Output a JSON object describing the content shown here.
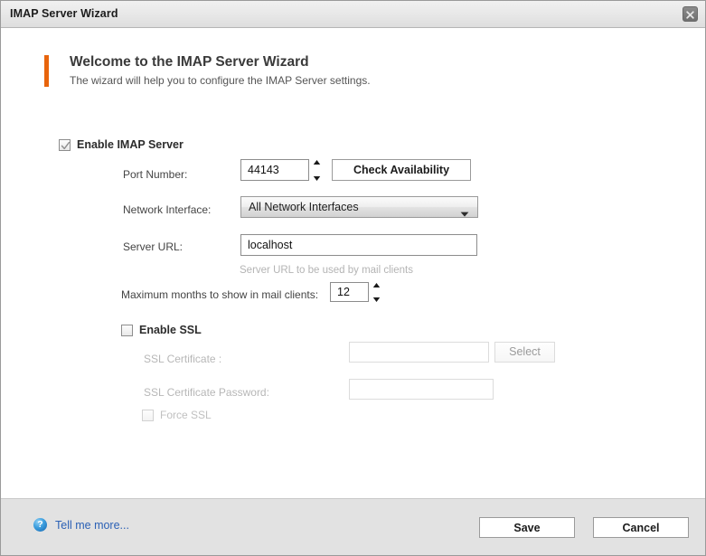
{
  "window": {
    "title": "IMAP Server Wizard",
    "close_icon": "close-icon"
  },
  "header": {
    "title": "Welcome to the IMAP Server Wizard",
    "subtitle": "The wizard will help you to configure the IMAP Server settings.",
    "accent_color": "#e8640c"
  },
  "form": {
    "enable_imap": {
      "label": "Enable IMAP Server",
      "checked": true
    },
    "port": {
      "label": "Port Number:",
      "value": "44143",
      "check_button": "Check Availability"
    },
    "network_interface": {
      "label": "Network Interface:",
      "selected": "All Network Interfaces",
      "options": [
        "All Network Interfaces"
      ]
    },
    "server_url": {
      "label": "Server URL:",
      "value": "localhost",
      "hint": "Server URL to be used by mail clients"
    },
    "max_months": {
      "label": "Maximum months to show in mail clients:",
      "value": "12"
    },
    "enable_ssl": {
      "label": "Enable SSL",
      "checked": false
    },
    "ssl_certificate": {
      "label": "SSL Certificate :",
      "value": "",
      "select_button": "Select"
    },
    "ssl_certificate_password": {
      "label": "SSL Certificate Password:",
      "value": ""
    },
    "force_ssl": {
      "label": "Force SSL",
      "checked": false
    }
  },
  "footer": {
    "help_icon": "help-question-icon",
    "help_label": "Tell me more...",
    "save_label": "Save",
    "cancel_label": "Cancel",
    "link_color": "#2c61b5"
  }
}
